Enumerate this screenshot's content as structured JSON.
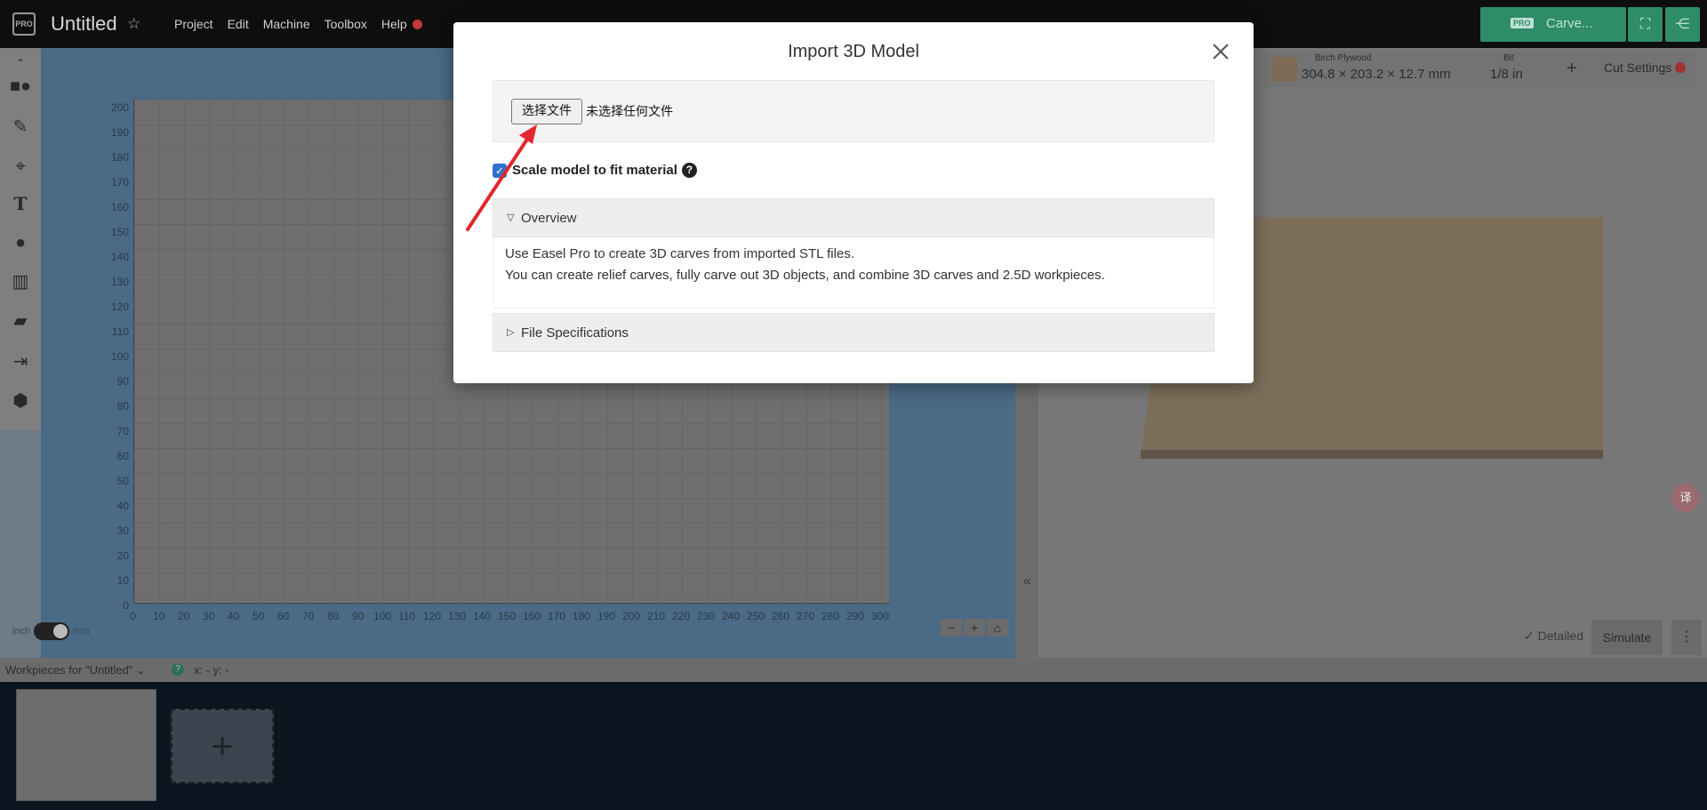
{
  "app": {
    "logo_text": "PRO",
    "doc_title": "Untitled",
    "menu": [
      "Project",
      "Edit",
      "Machine",
      "Toolbox",
      "Help"
    ],
    "carve": {
      "badge": "PRO",
      "label": "Carve..."
    }
  },
  "material": {
    "name": "Birch Plywood",
    "dims": "304.8 × 203.2 × 12.7 mm",
    "bit_title": "Bit",
    "bit_value": "1/8 in",
    "cut_settings": "Cut Settings"
  },
  "canvas": {
    "y_ticks": [
      "200",
      "190",
      "180",
      "170",
      "160",
      "150",
      "140",
      "130",
      "120",
      "110",
      "100",
      "90",
      "80",
      "70",
      "60",
      "50",
      "40",
      "30",
      "20",
      "10",
      "0"
    ],
    "x_ticks": [
      "0",
      "10",
      "20",
      "30",
      "40",
      "50",
      "60",
      "70",
      "80",
      "90",
      "100",
      "110",
      "120",
      "130",
      "140",
      "150",
      "160",
      "170",
      "180",
      "190",
      "200",
      "210",
      "220",
      "230",
      "240",
      "250",
      "260",
      "270",
      "280",
      "290",
      "300"
    ],
    "unit_left": "inch",
    "unit_right": "mm"
  },
  "preview": {
    "detailed_label": "✓ Detailed",
    "simulate_label": "Simulate"
  },
  "workpieces": {
    "label": "Workpieces for \"Untitled\" ⌄",
    "coords": "x: - y: -"
  },
  "modal": {
    "title": "Import 3D Model",
    "file_button": "选择文件",
    "file_status": "未选择任何文件",
    "scale_label": "Scale model to fit material",
    "scale_checked": true,
    "overview": {
      "heading": "Overview",
      "line1": "Use Easel Pro to create 3D carves from imported STL files.",
      "line2": "You can create relief carves, fully carve out 3D objects, and combine 3D carves and 2.5D workpieces."
    },
    "file_specs": {
      "heading": "File Specifications"
    }
  },
  "colors": {
    "carve_button": "#2e8c69",
    "annotation_arrow": "#e3262d",
    "checkbox": "#2f6fd0"
  }
}
